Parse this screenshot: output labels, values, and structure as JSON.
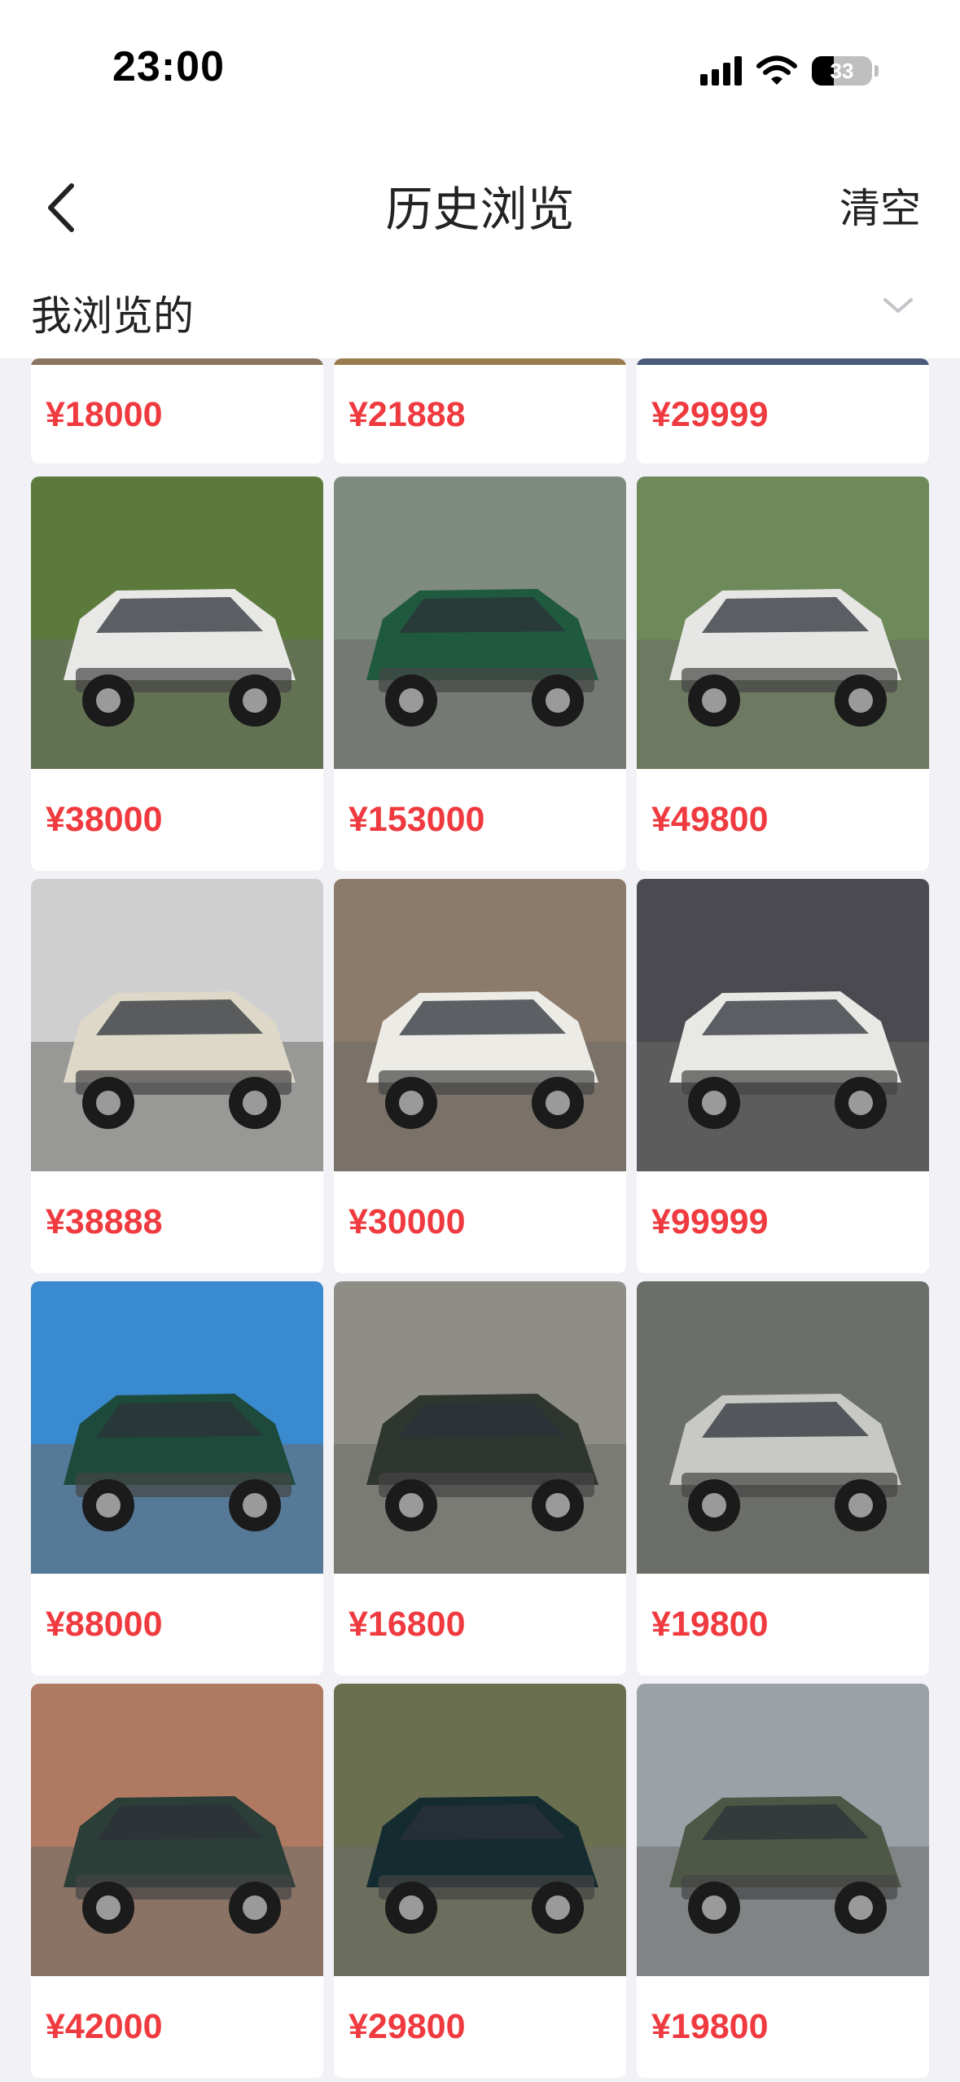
{
  "status_bar": {
    "time": "23:00",
    "battery": "33"
  },
  "nav": {
    "title": "历史浏览",
    "clear_label": "清空"
  },
  "filter": {
    "label": "我浏览的"
  },
  "accent_color": "#ef3a3f",
  "listings": [
    {
      "price": "¥18000",
      "color": "#8a7560"
    },
    {
      "price": "¥21888",
      "color": "#9a7b50"
    },
    {
      "price": "¥29999",
      "color": "#4a5a7a"
    },
    {
      "price": "¥38000",
      "color": "#e8e8e6",
      "scene": "#5c7a3c"
    },
    {
      "price": "¥153000",
      "color": "#1f5a3f",
      "scene": "#7f8a80"
    },
    {
      "price": "¥49800",
      "color": "#e6e6e4",
      "scene": "#6f8a5a"
    },
    {
      "price": "¥38888",
      "color": "#ddd8c8",
      "scene": "#cfcfcf"
    },
    {
      "price": "¥30000",
      "color": "#ecebe6",
      "scene": "#8c7a6a"
    },
    {
      "price": "¥99999",
      "color": "#e8e8e4",
      "scene": "#4a4a50"
    },
    {
      "price": "¥88000",
      "color": "#1d4a3a",
      "scene": "#3a8ad0"
    },
    {
      "price": "¥16800",
      "color": "#2f352f",
      "scene": "#8e8e86"
    },
    {
      "price": "¥19800",
      "color": "#c8c8c4",
      "scene": "#6a6f6a"
    },
    {
      "price": "¥42000",
      "color": "#2c3e38",
      "scene": "#b07a62"
    },
    {
      "price": "¥29800",
      "color": "#142b30",
      "scene": "#6a6f50"
    },
    {
      "price": "¥19800",
      "color": "#4e5746",
      "scene": "#9aa2a8"
    }
  ]
}
